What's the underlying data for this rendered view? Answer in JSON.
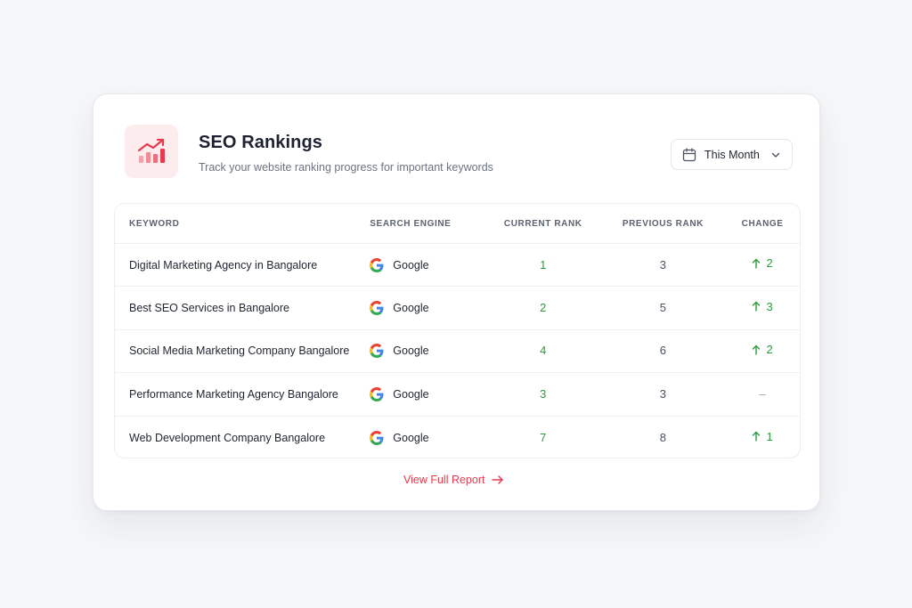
{
  "header": {
    "icon": "chart-trend-up-icon",
    "title": "SEO Rankings",
    "subtitle": "Track your website ranking progress for important keywords"
  },
  "period_select": {
    "icon": "calendar-icon",
    "selected": "This Month"
  },
  "table": {
    "columns": [
      "Keyword",
      "Search Engine",
      "Current Rank",
      "Previous Rank",
      "Change"
    ],
    "rows": [
      {
        "keyword": "Digital Marketing Agency in Bangalore",
        "engine": "Google",
        "current": "1",
        "previous": "3",
        "change": "2",
        "trend": "up"
      },
      {
        "keyword": "Best SEO Services in Bangalore",
        "engine": "Google",
        "current": "2",
        "previous": "5",
        "change": "3",
        "trend": "up"
      },
      {
        "keyword": "Social Media Marketing Company Bangalore",
        "engine": "Google",
        "current": "4",
        "previous": "6",
        "change": "2",
        "trend": "up"
      },
      {
        "keyword": "Performance Marketing Agency Bangalore",
        "engine": "Google",
        "current": "3",
        "previous": "3",
        "change": "–",
        "trend": "none"
      },
      {
        "keyword": "Web Development Company Bangalore",
        "engine": "Google",
        "current": "7",
        "previous": "8",
        "change": "1",
        "trend": "up"
      }
    ]
  },
  "footer": {
    "link_label": "View Full Report",
    "icon": "arrow-right-icon"
  },
  "colors": {
    "accent": "#e63b4e",
    "positive": "#2c9a3e",
    "neutral": "#9aa0aa",
    "icon_bg": "#fdecee"
  }
}
